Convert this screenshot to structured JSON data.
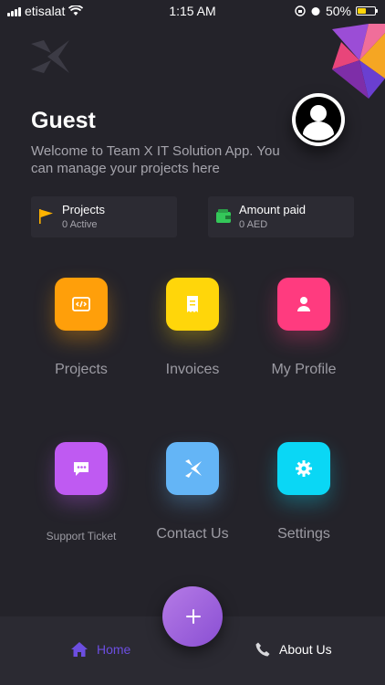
{
  "status_bar": {
    "carrier": "etisalat",
    "time": "1:15 AM",
    "battery": "50%",
    "battery_level": 0.5
  },
  "header": {
    "user_name": "Guest",
    "welcome_text": "Welcome to Team X IT Solution App. You can manage your projects here"
  },
  "stats": [
    {
      "title": "Projects",
      "subtitle": "0 Active",
      "icon": "flag-icon"
    },
    {
      "title": "Amount paid",
      "subtitle": "0 AED",
      "icon": "wallet-icon"
    }
  ],
  "menu": [
    {
      "label": "Projects",
      "icon": "code-icon",
      "color": "#ff9f0a"
    },
    {
      "label": "Invoices",
      "icon": "receipt-icon",
      "color": "#ffd60a"
    },
    {
      "label": "My Profile",
      "icon": "user-icon",
      "color": "#ff3b7f"
    },
    {
      "label": "Support Ticket",
      "icon": "chat-icon",
      "color": "#bf5af2"
    },
    {
      "label": "Contact Us",
      "icon": "teamx-icon",
      "color": "#64b5f6"
    },
    {
      "label": "Settings",
      "icon": "gear-icon",
      "color": "#0ad7f5"
    }
  ],
  "bottom_nav": {
    "home_label": "Home",
    "about_label": "About Us",
    "accent_color": "#6c4ee0"
  }
}
